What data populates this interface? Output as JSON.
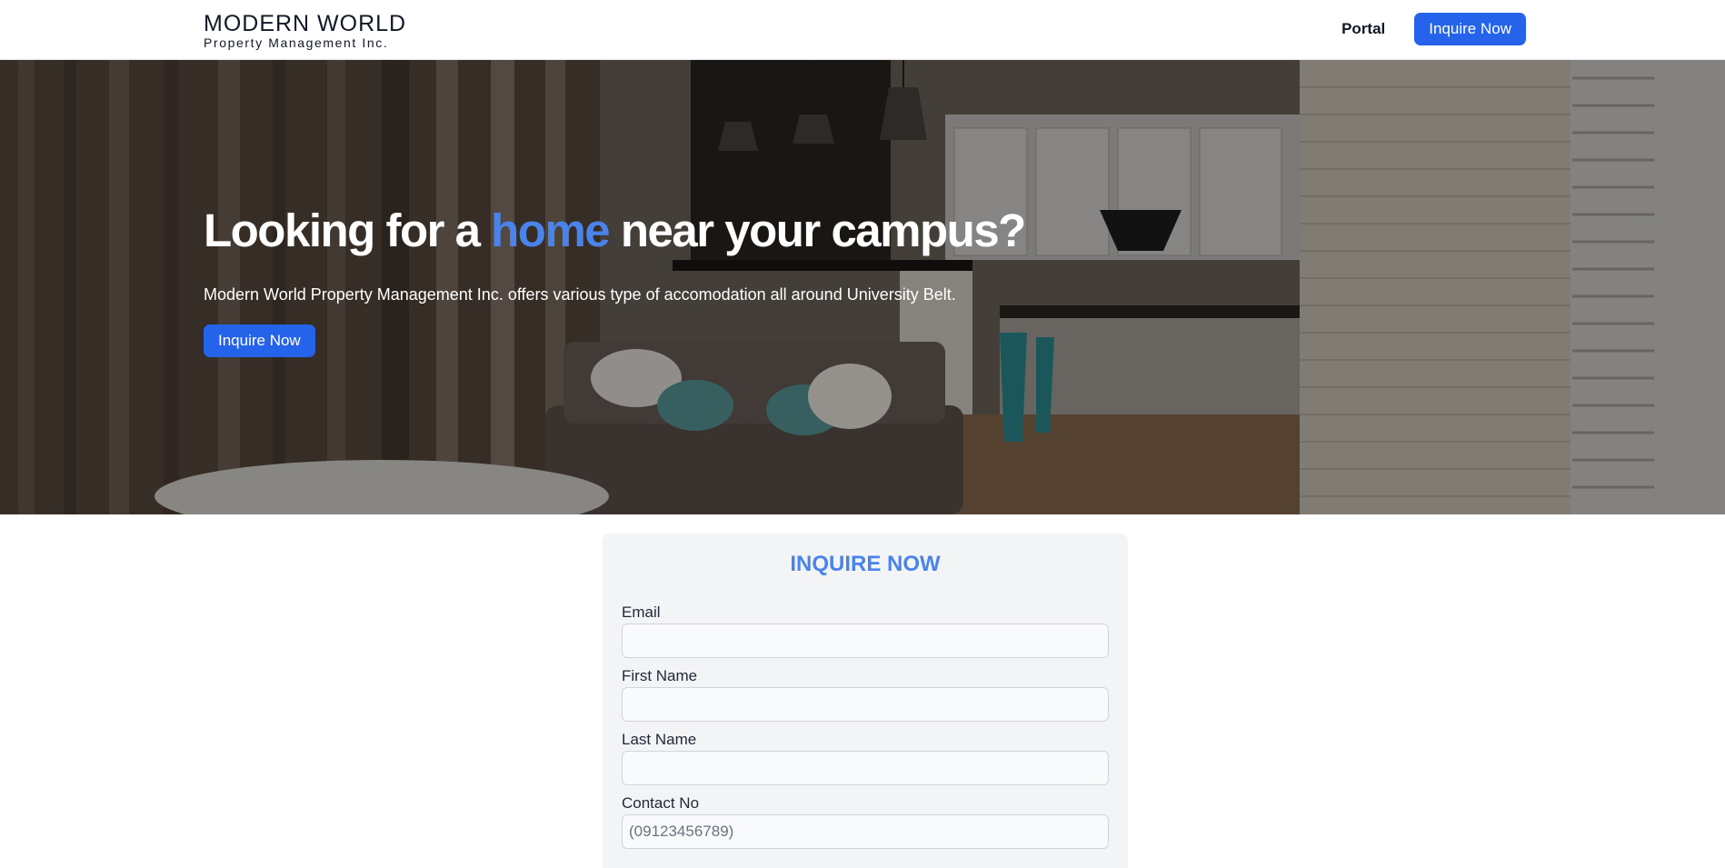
{
  "header": {
    "logo_title": "MODERN WORLD",
    "logo_subtitle": "Property Management Inc.",
    "nav_portal": "Portal",
    "nav_inquire": "Inquire Now"
  },
  "hero": {
    "title_before": "Looking for a ",
    "title_accent": "home",
    "title_after": " near your campus?",
    "description": "Modern World Property Management Inc. offers various type of accomodation all around University Belt.",
    "cta": "Inquire Now"
  },
  "form": {
    "title": "INQUIRE NOW",
    "fields": [
      {
        "label": "Email",
        "value": "",
        "placeholder": ""
      },
      {
        "label": "First Name",
        "value": "",
        "placeholder": ""
      },
      {
        "label": "Last Name",
        "value": "",
        "placeholder": ""
      },
      {
        "label": "Contact No",
        "value": "",
        "placeholder": "(09123456789)"
      }
    ]
  },
  "colors": {
    "primary": "#2563eb",
    "accent": "#4a83ea",
    "card": "#f3f4f6"
  }
}
